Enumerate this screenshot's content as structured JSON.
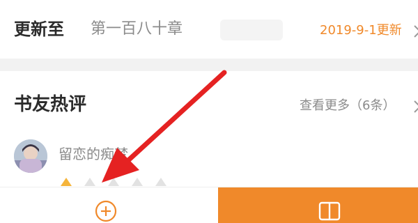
{
  "update": {
    "label": "更新至",
    "chapter": "第一百八十章",
    "date": "2019-9-1更新"
  },
  "reviews": {
    "title": "书友热评",
    "view_more": "查看更多（6条）",
    "items": [
      {
        "reviewer": "留恋的痴梦",
        "rating": 1,
        "rating_max": 5
      }
    ]
  },
  "bottom_bar": {
    "add_icon": "plus-circle-icon",
    "read_icon": "open-book-icon"
  },
  "colors": {
    "accent": "#f0892a",
    "arrow": "#e52222",
    "muted_text": "#8b8b8b",
    "title_text": "#2b2b2b",
    "divider": "#f2f2f2"
  }
}
